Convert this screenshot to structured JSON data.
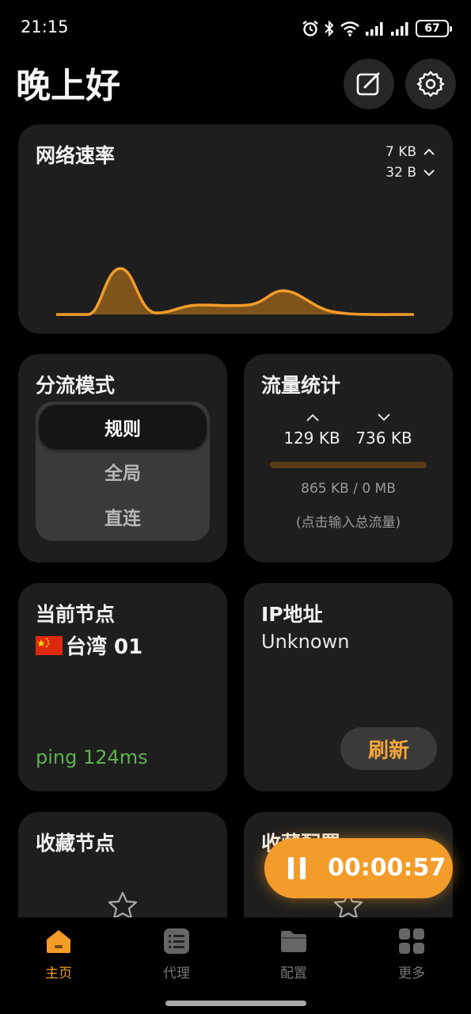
{
  "status_bar": {
    "time": "21:15",
    "battery": "67"
  },
  "header": {
    "greeting": "晚上好"
  },
  "speed_card": {
    "title": "网络速率",
    "upload": "7 KB",
    "download": "32 B"
  },
  "mode_card": {
    "title": "分流模式",
    "options": [
      "规则",
      "全局",
      "直连"
    ],
    "selected": "规则"
  },
  "traffic_card": {
    "title": "流量统计",
    "upload": "129 KB",
    "download": "736 KB",
    "total": "865 KB / 0 MB",
    "hint": "(点击输入总流量)"
  },
  "node_card": {
    "title": "当前节点",
    "node_name": "台湾 01",
    "ping": "ping 124ms"
  },
  "ip_card": {
    "title": "IP地址",
    "value": "Unknown",
    "refresh_label": "刷新"
  },
  "fav_nodes_card": {
    "title": "收藏节点"
  },
  "fav_configs_card": {
    "title": "收藏配置"
  },
  "timer": {
    "elapsed": "00:00:57"
  },
  "nav": {
    "items": [
      {
        "label": "主页",
        "icon": "home-icon",
        "active": true
      },
      {
        "label": "代理",
        "icon": "list-icon",
        "active": false
      },
      {
        "label": "配置",
        "icon": "folder-icon",
        "active": false
      },
      {
        "label": "更多",
        "icon": "grid-icon",
        "active": false
      }
    ]
  },
  "colors": {
    "accent": "#f39c2a",
    "card_bg": "#1e1e1e",
    "ping_green": "#5db24e"
  }
}
